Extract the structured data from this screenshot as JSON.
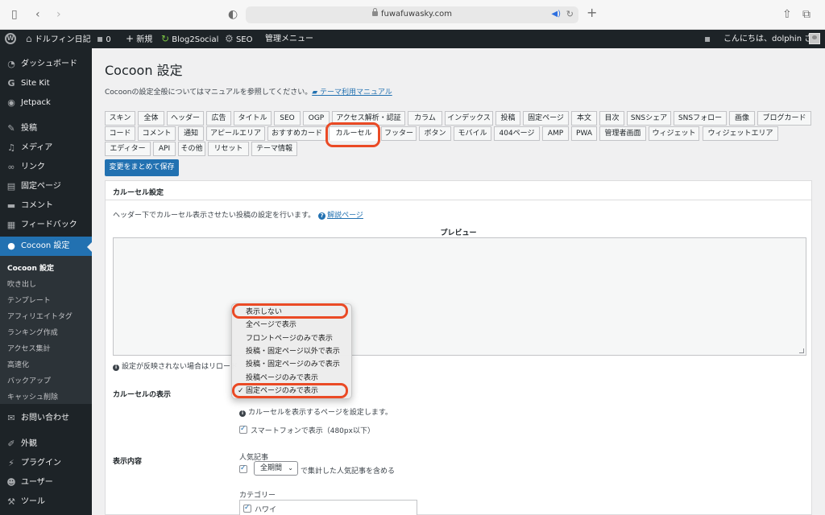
{
  "browser": {
    "url": "fuwafuwasky.com"
  },
  "adminbar": {
    "site_name": "ドルフィン日記",
    "comments_count": "0",
    "new_label": "新規",
    "blog2social": "Blog2Social",
    "seo": "SEO",
    "admin_menu": "管理メニュー",
    "greeting": "こんにちは、dolphin さん"
  },
  "sidebar": {
    "items": [
      {
        "label": "ダッシュボード",
        "icon": "dashboard-icon"
      },
      {
        "label": "Site Kit",
        "icon": "google-g-icon"
      },
      {
        "label": "Jetpack",
        "icon": "jetpack-icon"
      },
      {
        "label": "投稿",
        "icon": "pin-icon"
      },
      {
        "label": "メディア",
        "icon": "media-icon"
      },
      {
        "label": "リンク",
        "icon": "link-icon"
      },
      {
        "label": "固定ページ",
        "icon": "page-icon"
      },
      {
        "label": "コメント",
        "icon": "comment-icon"
      },
      {
        "label": "フィードバック",
        "icon": "feedback-icon"
      },
      {
        "label": "Cocoon 設定",
        "icon": "cocoon-icon"
      }
    ],
    "submenu": [
      "Cocoon 設定",
      "吹き出し",
      "テンプレート",
      "アフィリエイトタグ",
      "ランキング作成",
      "アクセス集計",
      "高速化",
      "バックアップ",
      "キャッシュ削除"
    ],
    "bottom_items": [
      {
        "label": "お問い合わせ",
        "icon": "mail-icon"
      },
      {
        "label": "外観",
        "icon": "brush-icon"
      },
      {
        "label": "プラグイン",
        "icon": "plugin-icon"
      },
      {
        "label": "ユーザー",
        "icon": "user-icon"
      },
      {
        "label": "ツール",
        "icon": "wrench-icon"
      }
    ]
  },
  "main": {
    "title": "Cocoon 設定",
    "intro_text": "Cocoonの設定全般についてはマニュアルを参照してください。",
    "manual_link": "テーマ利用マニュアル",
    "tabs_row1": [
      "スキン",
      "全体",
      "ヘッダー",
      "広告",
      "タイトル",
      "SEO",
      "OGP",
      "アクセス解析・認証",
      "カラム",
      "インデックス",
      "投稿",
      "固定ページ",
      "本文",
      "目次",
      "SNSシェア",
      "SNSフォロー",
      "画像",
      "ブログカード"
    ],
    "tabs_row2": [
      "コード",
      "コメント",
      "通知",
      "アピールエリア",
      "おすすめカード",
      "カルーセル",
      "フッター",
      "ボタン",
      "モバイル",
      "404ページ",
      "AMP",
      "PWA",
      "管理者画面",
      "ウィジェット",
      "ウィジェットエリア"
    ],
    "tabs_row3": [
      "エディター",
      "API",
      "その他",
      "リセット",
      "テーマ情報"
    ],
    "active_tab": "カルーセル",
    "save_button": "変更をまとめて保存"
  },
  "panel": {
    "title": "カルーセル設定",
    "description": "ヘッダー下でカルーセル表示させたい投稿の設定を行います。",
    "help_link": "解説ページ",
    "preview_label": "プレビュー",
    "info_text": "設定が反映されない場合はリロード",
    "carousel_display_label": "カルーセルの表示",
    "carousel_display_note": "カルーセルを表示するページを設定します。",
    "smartphone_label": "スマートフォンで表示（480px以下）",
    "smartphone_checked": true,
    "display_content_label": "表示内容",
    "popular_heading": "人気記事",
    "popular_checked": true,
    "period_value": "全期間",
    "popular_suffix": "で集計した人気記事を含める",
    "category_heading": "カテゴリー",
    "category_first": "ハワイ",
    "category_first_checked": true
  },
  "dropdown": {
    "options": [
      "表示しない",
      "全ページで表示",
      "フロントページのみで表示",
      "投稿・固定ページ以外で表示",
      "投稿・固定ページのみで表示",
      "投稿ページのみで表示",
      "固定ページのみで表示"
    ],
    "selected": "固定ページのみで表示",
    "check_mark": "✓"
  },
  "colors": {
    "admin_dark": "#1d2327",
    "accent_blue": "#2271b1",
    "highlight_red": "#ea4a25"
  }
}
